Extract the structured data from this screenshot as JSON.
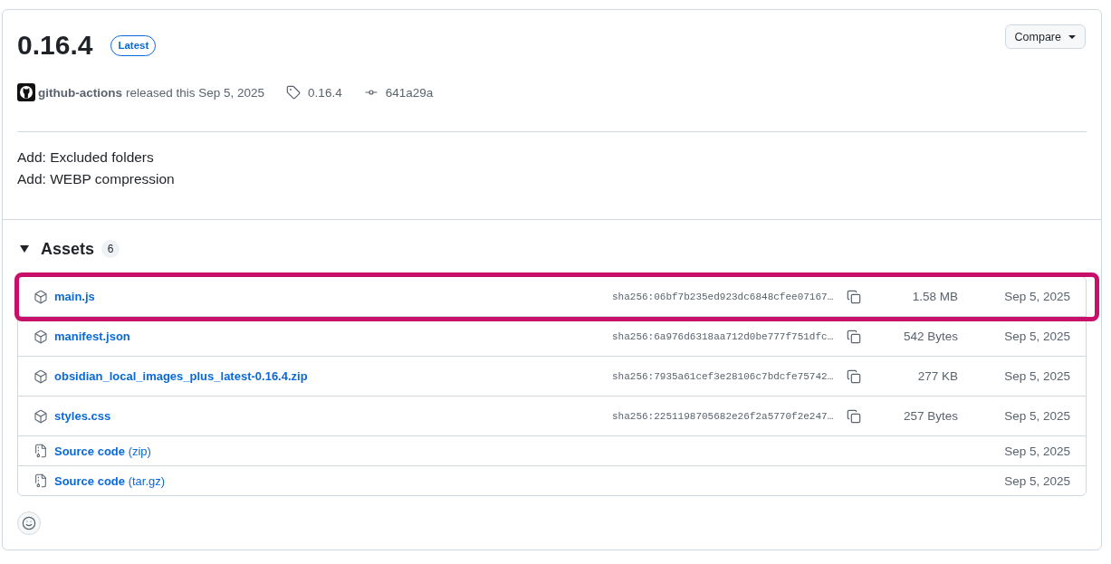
{
  "release": {
    "version": "0.16.4",
    "badge": "Latest",
    "compare_button": "Compare",
    "author": "github-actions",
    "released_text": "released this Sep 5, 2025",
    "tag": "0.16.4",
    "commit": "641a29a"
  },
  "notes": [
    "Add: Excluded folders",
    "Add: WEBP compression"
  ],
  "assets": {
    "title": "Assets",
    "count": "6",
    "expanded": true,
    "items": [
      {
        "kind": "package",
        "name": "main.js",
        "hash": "sha256:06bf7b235ed923dc6848cfee07167…",
        "size": "1.58 MB",
        "date": "Sep 5, 2025",
        "highlighted": true
      },
      {
        "kind": "package",
        "name": "manifest.json",
        "hash": "sha256:6a976d6318aa712d0be777f751dfc…",
        "size": "542 Bytes",
        "date": "Sep 5, 2025",
        "highlighted": false
      },
      {
        "kind": "package",
        "name": "obsidian_local_images_plus_latest-0.16.4.zip",
        "hash": "sha256:7935a61cef3e28106c7bdcfe75742…",
        "size": "277 KB",
        "date": "Sep 5, 2025",
        "highlighted": false
      },
      {
        "kind": "package",
        "name": "styles.css",
        "hash": "sha256:2251198705682e26f2a5770f2e247…",
        "size": "257 Bytes",
        "date": "Sep 5, 2025",
        "highlighted": false
      },
      {
        "kind": "source",
        "name": "**Source code** (zip)",
        "date": "Sep 5, 2025",
        "highlighted": false
      },
      {
        "kind": "source",
        "name": "**Source code** (tar.gz)",
        "date": "Sep 5, 2025",
        "highlighted": false
      }
    ]
  }
}
